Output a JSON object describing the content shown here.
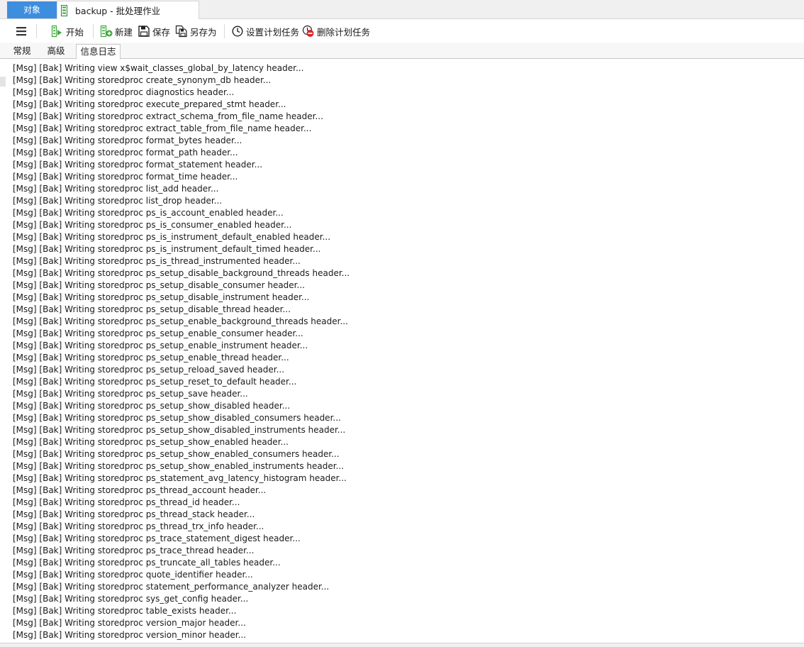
{
  "tabs": {
    "objects_label": "对象",
    "document_title": "backup - 批处理作业"
  },
  "toolbar": {
    "start_label": "开始",
    "new_label": "新建",
    "save_label": "保存",
    "save_as_label": "另存为",
    "set_schedule_label": "设置计划任务",
    "delete_schedule_label": "删除计划任务"
  },
  "subtabs": {
    "general_label": "常规",
    "advanced_label": "高级",
    "log_label": "信息日志"
  },
  "colors": {
    "accent_tab": "#3d8ede",
    "start_green": "#3aa63a",
    "delete_red": "#d9262b"
  },
  "log": {
    "lines": [
      "[Msg] [Bak] Writing view x$wait_classes_global_by_latency header...",
      "[Msg] [Bak] Writing storedproc create_synonym_db header...",
      "[Msg] [Bak] Writing storedproc diagnostics header...",
      "[Msg] [Bak] Writing storedproc execute_prepared_stmt header...",
      "[Msg] [Bak] Writing storedproc extract_schema_from_file_name header...",
      "[Msg] [Bak] Writing storedproc extract_table_from_file_name header...",
      "[Msg] [Bak] Writing storedproc format_bytes header...",
      "[Msg] [Bak] Writing storedproc format_path header...",
      "[Msg] [Bak] Writing storedproc format_statement header...",
      "[Msg] [Bak] Writing storedproc format_time header...",
      "[Msg] [Bak] Writing storedproc list_add header...",
      "[Msg] [Bak] Writing storedproc list_drop header...",
      "[Msg] [Bak] Writing storedproc ps_is_account_enabled header...",
      "[Msg] [Bak] Writing storedproc ps_is_consumer_enabled header...",
      "[Msg] [Bak] Writing storedproc ps_is_instrument_default_enabled header...",
      "[Msg] [Bak] Writing storedproc ps_is_instrument_default_timed header...",
      "[Msg] [Bak] Writing storedproc ps_is_thread_instrumented header...",
      "[Msg] [Bak] Writing storedproc ps_setup_disable_background_threads header...",
      "[Msg] [Bak] Writing storedproc ps_setup_disable_consumer header...",
      "[Msg] [Bak] Writing storedproc ps_setup_disable_instrument header...",
      "[Msg] [Bak] Writing storedproc ps_setup_disable_thread header...",
      "[Msg] [Bak] Writing storedproc ps_setup_enable_background_threads header...",
      "[Msg] [Bak] Writing storedproc ps_setup_enable_consumer header...",
      "[Msg] [Bak] Writing storedproc ps_setup_enable_instrument header...",
      "[Msg] [Bak] Writing storedproc ps_setup_enable_thread header...",
      "[Msg] [Bak] Writing storedproc ps_setup_reload_saved header...",
      "[Msg] [Bak] Writing storedproc ps_setup_reset_to_default header...",
      "[Msg] [Bak] Writing storedproc ps_setup_save header...",
      "[Msg] [Bak] Writing storedproc ps_setup_show_disabled header...",
      "[Msg] [Bak] Writing storedproc ps_setup_show_disabled_consumers header...",
      "[Msg] [Bak] Writing storedproc ps_setup_show_disabled_instruments header...",
      "[Msg] [Bak] Writing storedproc ps_setup_show_enabled header...",
      "[Msg] [Bak] Writing storedproc ps_setup_show_enabled_consumers header...",
      "[Msg] [Bak] Writing storedproc ps_setup_show_enabled_instruments header...",
      "[Msg] [Bak] Writing storedproc ps_statement_avg_latency_histogram header...",
      "[Msg] [Bak] Writing storedproc ps_thread_account header...",
      "[Msg] [Bak] Writing storedproc ps_thread_id header...",
      "[Msg] [Bak] Writing storedproc ps_thread_stack header...",
      "[Msg] [Bak] Writing storedproc ps_thread_trx_info header...",
      "[Msg] [Bak] Writing storedproc ps_trace_statement_digest header...",
      "[Msg] [Bak] Writing storedproc ps_trace_thread header...",
      "[Msg] [Bak] Writing storedproc ps_truncate_all_tables header...",
      "[Msg] [Bak] Writing storedproc quote_identifier header...",
      "[Msg] [Bak] Writing storedproc statement_performance_analyzer header...",
      "[Msg] [Bak] Writing storedproc sys_get_config header...",
      "[Msg] [Bak] Writing storedproc table_exists header...",
      "[Msg] [Bak] Writing storedproc version_major header...",
      "[Msg] [Bak] Writing storedproc version_minor header..."
    ]
  }
}
